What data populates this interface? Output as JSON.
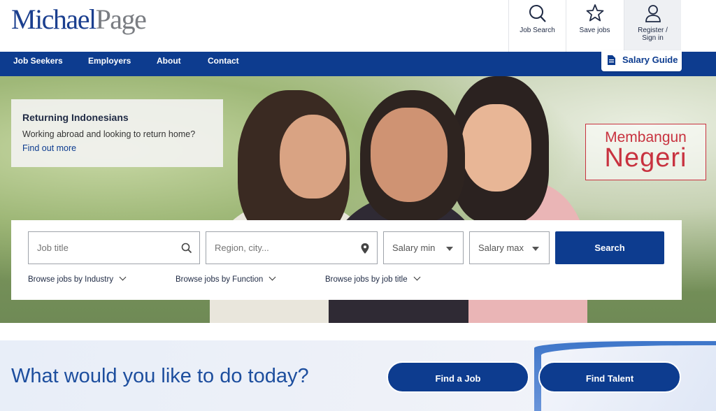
{
  "header": {
    "logo_part1": "Michael",
    "logo_part2": "Page",
    "job_search": "Job Search",
    "save_jobs": "Save jobs",
    "register_line1": "Register /",
    "register_line2": "Sign in"
  },
  "nav": {
    "items": [
      "Job Seekers",
      "Employers",
      "About",
      "Contact"
    ],
    "salary_guide": "Salary Guide"
  },
  "promo": {
    "title": "Returning Indonesians",
    "subtitle": "Working abroad and looking to return home?",
    "link": "Find out more"
  },
  "badge": {
    "line1": "Membangun",
    "line2": "Negeri"
  },
  "search": {
    "job_title_placeholder": "Job title",
    "region_placeholder": "Region, city...",
    "salary_min": "Salary min",
    "salary_max": "Salary max",
    "button": "Search",
    "browse_industry": "Browse jobs by Industry",
    "browse_function": "Browse jobs by Function",
    "browse_title": "Browse jobs by job title"
  },
  "bottom": {
    "question": "What would you like to do today?",
    "find_job": "Find a Job",
    "find_talent": "Find Talent"
  },
  "colors": {
    "brand_blue": "#0d3c8f",
    "badge_red": "#c8323f"
  }
}
